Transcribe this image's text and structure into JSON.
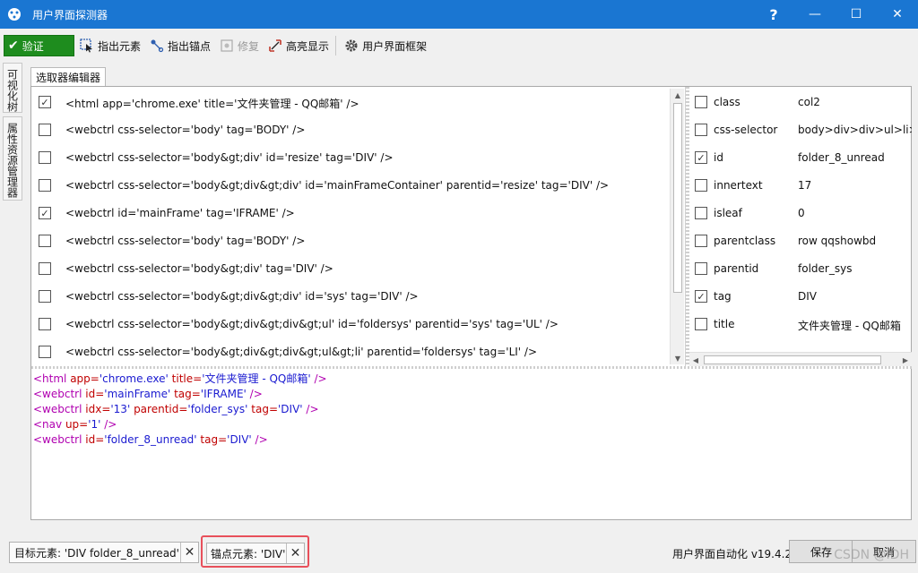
{
  "window": {
    "title": "用户界面探测器",
    "help_label": "?",
    "minimize_label": "—",
    "maximize_label": "☐",
    "close_label": "✕",
    "title_bar_color": "#1a76d2"
  },
  "toolbar": {
    "validate_label": "验证",
    "validate_icon": "check-icon",
    "validate_color": "#1e8c1e",
    "indicate_element_label": "指出元素",
    "indicate_anchor_label": "指出锚点",
    "repair_label": "修复",
    "highlight_label": "高亮显示",
    "ui_framework_label": "用户界面框架"
  },
  "side_tabs": [
    "可视化树",
    "属性资源管理器"
  ],
  "main_tab": "选取器编辑器",
  "selectors": [
    {
      "checked": true,
      "text": "<html app='chrome.exe' title='文件夹管理 - QQ邮箱' />"
    },
    {
      "checked": false,
      "text": "<webctrl css-selector='body' tag='BODY' />"
    },
    {
      "checked": false,
      "text": "<webctrl css-selector='body&gt;div' id='resize' tag='DIV' />"
    },
    {
      "checked": false,
      "text": "<webctrl css-selector='body&gt;div&gt;div' id='mainFrameContainer' parentid='resize' tag='DIV' />"
    },
    {
      "checked": true,
      "text": "<webctrl id='mainFrame' tag='IFRAME' />"
    },
    {
      "checked": false,
      "text": "<webctrl css-selector='body' tag='BODY' />"
    },
    {
      "checked": false,
      "text": "<webctrl css-selector='body&gt;div' tag='DIV' />"
    },
    {
      "checked": false,
      "text": "<webctrl css-selector='body&gt;div&gt;div' id='sys' tag='DIV' />"
    },
    {
      "checked": false,
      "text": "<webctrl css-selector='body&gt;div&gt;div&gt;ul' id='foldersys' parentid='sys' tag='UL' />"
    },
    {
      "checked": false,
      "text": "<webctrl css-selector='body&gt;div&gt;div&gt;ul&gt;li' parentid='foldersys' tag='LI' />"
    }
  ],
  "properties": [
    {
      "checked": false,
      "key": "class",
      "value": "col2"
    },
    {
      "checked": false,
      "key": "css-selector",
      "value": "body>div>div>ul>li>"
    },
    {
      "checked": true,
      "key": "id",
      "value": "folder_8_unread"
    },
    {
      "checked": false,
      "key": "innertext",
      "value": "17"
    },
    {
      "checked": false,
      "key": "isleaf",
      "value": "0"
    },
    {
      "checked": false,
      "key": "parentclass",
      "value": "row qqshowbd"
    },
    {
      "checked": false,
      "key": "parentid",
      "value": "folder_sys"
    },
    {
      "checked": true,
      "key": "tag",
      "value": "DIV"
    },
    {
      "checked": false,
      "key": "title",
      "value": "文件夹管理 - QQ邮箱"
    }
  ],
  "code_lines": [
    [
      {
        "c": "tag",
        "t": "<html "
      },
      {
        "c": "attr",
        "t": "app="
      },
      {
        "c": "val",
        "t": "'chrome.exe'"
      },
      {
        "c": "attr",
        "t": " title="
      },
      {
        "c": "val",
        "t": "'文件夹管理 - QQ邮箱'"
      },
      {
        "c": "tag",
        "t": " />"
      }
    ],
    [
      {
        "c": "tag",
        "t": "<webctrl "
      },
      {
        "c": "attr",
        "t": "id="
      },
      {
        "c": "val",
        "t": "'mainFrame'"
      },
      {
        "c": "attr",
        "t": " tag="
      },
      {
        "c": "val",
        "t": "'IFRAME'"
      },
      {
        "c": "tag",
        "t": " />"
      }
    ],
    [
      {
        "c": "tag",
        "t": "<webctrl "
      },
      {
        "c": "attr",
        "t": "idx="
      },
      {
        "c": "val",
        "t": "'13'"
      },
      {
        "c": "attr",
        "t": " parentid="
      },
      {
        "c": "val",
        "t": "'folder_sys'"
      },
      {
        "c": "attr",
        "t": " tag="
      },
      {
        "c": "val",
        "t": "'DIV'"
      },
      {
        "c": "tag",
        "t": " />"
      }
    ],
    [
      {
        "c": "tag",
        "t": "<nav "
      },
      {
        "c": "attr",
        "t": "up="
      },
      {
        "c": "val",
        "t": "'1'"
      },
      {
        "c": "tag",
        "t": " />"
      }
    ],
    [
      {
        "c": "tag",
        "t": "<webctrl "
      },
      {
        "c": "attr",
        "t": "id="
      },
      {
        "c": "val",
        "t": "'folder_8_unread'"
      },
      {
        "c": "attr",
        "t": " tag="
      },
      {
        "c": "val",
        "t": "'DIV'"
      },
      {
        "c": "tag",
        "t": " />"
      }
    ]
  ],
  "status": {
    "target_label": "目标元素: 'DIV  folder_8_unread'",
    "anchor_label": "锚点元素: 'DIV'",
    "version": "用户界面自动化 v19.4.2",
    "save_label": "保存",
    "cancel_label": "取消",
    "watermark": "CSDN @IDH"
  }
}
